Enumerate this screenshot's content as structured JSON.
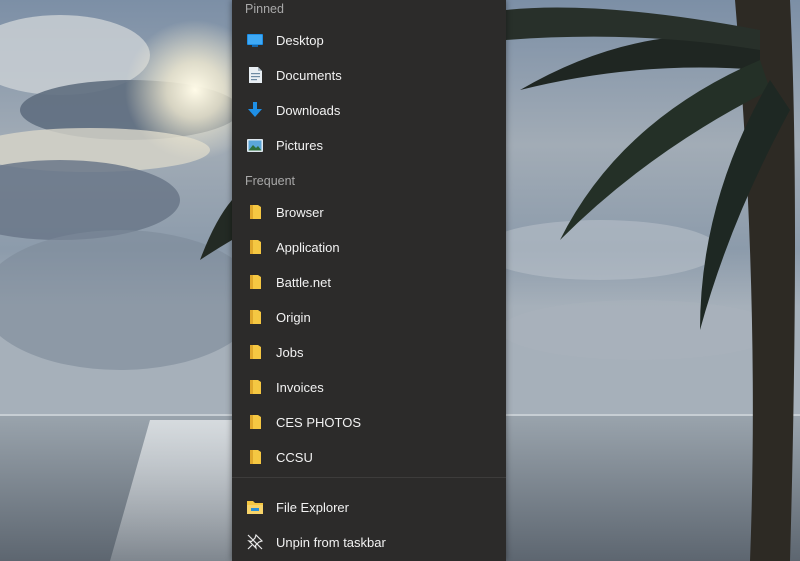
{
  "jumplist": {
    "pinned_header": "Pinned",
    "pinned": [
      {
        "label": "Desktop",
        "icon": "desktop-icon"
      },
      {
        "label": "Documents",
        "icon": "documents-icon"
      },
      {
        "label": "Downloads",
        "icon": "downloads-icon"
      },
      {
        "label": "Pictures",
        "icon": "pictures-icon"
      }
    ],
    "frequent_header": "Frequent",
    "frequent": [
      {
        "label": "Browser",
        "icon": "folder-icon"
      },
      {
        "label": "Application",
        "icon": "folder-icon"
      },
      {
        "label": "Battle.net",
        "icon": "folder-icon"
      },
      {
        "label": "Origin",
        "icon": "folder-icon"
      },
      {
        "label": "Jobs",
        "icon": "folder-icon"
      },
      {
        "label": "Invoices",
        "icon": "folder-icon"
      },
      {
        "label": "CES PHOTOS",
        "icon": "folder-icon"
      },
      {
        "label": "CCSU",
        "icon": "folder-icon"
      }
    ],
    "actions": [
      {
        "label": "File Explorer",
        "icon": "file-explorer-icon"
      },
      {
        "label": "Unpin from taskbar",
        "icon": "unpin-icon"
      }
    ]
  },
  "colors": {
    "menu_background": "#2c2b2a",
    "folder_yellow": "#f5c742",
    "accent_blue": "#1e8fe6"
  }
}
